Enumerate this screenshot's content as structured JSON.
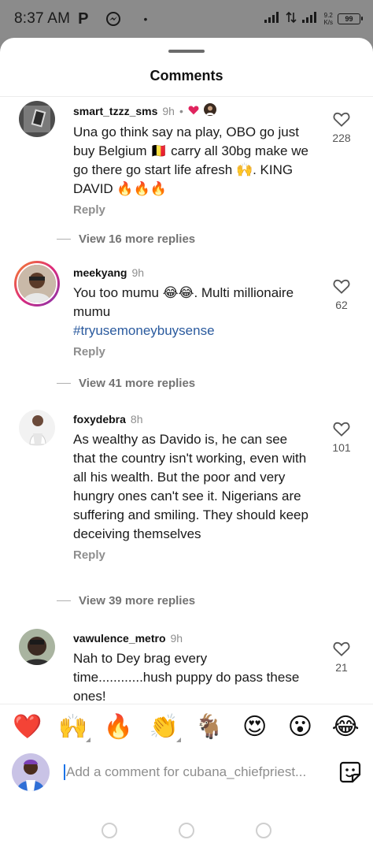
{
  "status_bar": {
    "time": "8:37 AM",
    "app_letter": "P",
    "dot": "•",
    "speed_value": "9.2",
    "speed_unit": "K/s",
    "battery": "99"
  },
  "sheet": {
    "title": "Comments"
  },
  "comments": [
    {
      "username": "smart_tzzz_sms",
      "time": "9h",
      "separator": "•",
      "text": "Una go think say na play, OBO go just buy Belgium 🇧🇪 carry all 30bg make we go there go start life afresh 🙌. KING DAVID 🔥🔥🔥",
      "hashtag": "",
      "reply_label": "Reply",
      "like_count": "228",
      "view_replies": "View 16 more replies"
    },
    {
      "username": "meekyang",
      "time": "9h",
      "text": "You too mumu 😂😂. Multi millionaire mumu",
      "hashtag": "#tryusemoneybuysense",
      "reply_label": "Reply",
      "like_count": "62",
      "view_replies": "View 41 more replies"
    },
    {
      "username": "foxydebra",
      "time": "8h",
      "text": "As wealthy as Davido is, he can see that the country isn't working, even with all his wealth. But the poor and very hungry ones can't see it. Nigerians are suffering and smiling. They should keep deceiving themselves",
      "hashtag": "",
      "reply_label": "Reply",
      "like_count": "101",
      "view_replies": "View 39 more replies"
    },
    {
      "username": "vawulence_metro",
      "time": "9h",
      "text": "Nah to Dey brag every time............hush puppy do pass these ones!",
      "hashtag": "",
      "reply_label": "",
      "like_count": "21",
      "view_replies": ""
    }
  ],
  "emoji_bar": [
    "❤️",
    "🙌",
    "🔥",
    "👏",
    "🐐",
    "😍",
    "😮",
    "😂"
  ],
  "input": {
    "placeholder": "Add a comment for cubana_chiefpriest..."
  },
  "colors": {
    "like_heart_top": "#e0245e",
    "hashtag": "#2a5a9e",
    "cursor": "#1a73e8"
  }
}
